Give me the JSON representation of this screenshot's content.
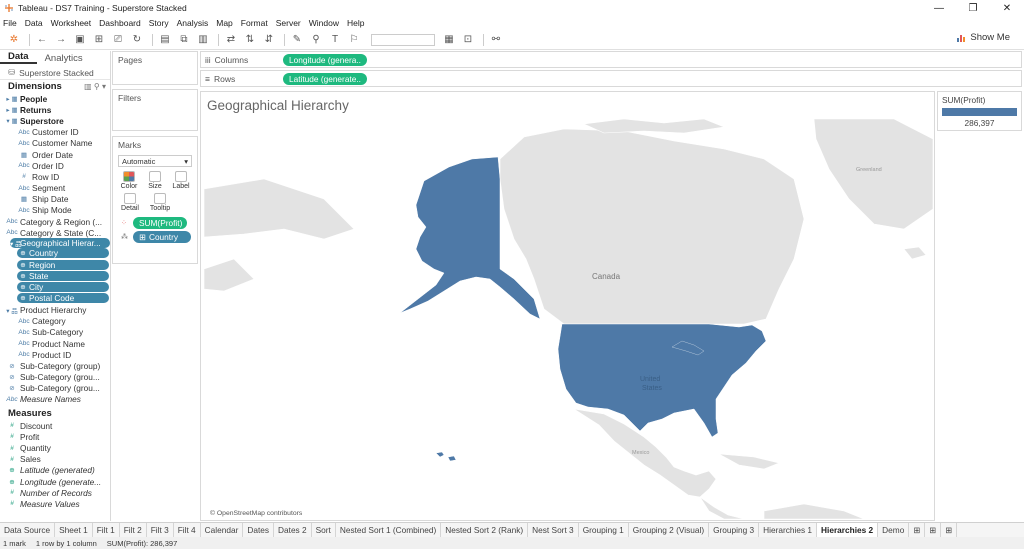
{
  "window": {
    "title": "Tableau - DS7 Training - Superstore Stacked",
    "controls": [
      "—",
      "❐",
      "✕"
    ]
  },
  "menu": [
    "File",
    "Data",
    "Worksheet",
    "Dashboard",
    "Story",
    "Analysis",
    "Map",
    "Format",
    "Server",
    "Window",
    "Help"
  ],
  "toolbar": {
    "show_me": "Show Me"
  },
  "left_panel": {
    "tabs": [
      "Data",
      "Analytics"
    ],
    "datasource": "Superstore Stacked",
    "dimensions_label": "Dimensions",
    "measures_label": "Measures",
    "dimension_rows": [
      {
        "icon": "▸ ▦",
        "label": "People",
        "kind": "grp"
      },
      {
        "icon": "▸ ▦",
        "label": "Returns",
        "kind": "grp"
      },
      {
        "icon": "▾ ▦",
        "label": "Superstore",
        "kind": "grp"
      },
      {
        "icon": "Abc",
        "label": "Customer ID",
        "kind": "indent"
      },
      {
        "icon": "Abc",
        "label": "Customer Name",
        "kind": "indent"
      },
      {
        "icon": "▦",
        "label": "Order Date",
        "kind": "indent"
      },
      {
        "icon": "Abc",
        "label": "Order ID",
        "kind": "indent"
      },
      {
        "icon": "#",
        "label": "Row ID",
        "kind": "indent"
      },
      {
        "icon": "Abc",
        "label": "Segment",
        "kind": "indent"
      },
      {
        "icon": "▦",
        "label": "Ship Date",
        "kind": "indent"
      },
      {
        "icon": "Abc",
        "label": "Ship Mode",
        "kind": "indent"
      },
      {
        "icon": "Abc",
        "label": "Category & Region (...",
        "kind": "plain"
      },
      {
        "icon": "Abc",
        "label": "Category & State (C...",
        "kind": "plain"
      },
      {
        "icon": "▾ 品",
        "label": "Geographical Hierar...",
        "kind": "hier"
      },
      {
        "icon": "⊕",
        "label": "Country",
        "kind": "pill"
      },
      {
        "icon": "⊕",
        "label": "Region",
        "kind": "pill"
      },
      {
        "icon": "⊕",
        "label": "State",
        "kind": "pill"
      },
      {
        "icon": "⊕",
        "label": "City",
        "kind": "pill"
      },
      {
        "icon": "⊕",
        "label": "Postal Code",
        "kind": "pill"
      },
      {
        "icon": "▾ 品",
        "label": "Product Hierarchy",
        "kind": "plain"
      },
      {
        "icon": "Abc",
        "label": "Category",
        "kind": "indent"
      },
      {
        "icon": "Abc",
        "label": "Sub-Category",
        "kind": "indent"
      },
      {
        "icon": "Abc",
        "label": "Product Name",
        "kind": "indent"
      },
      {
        "icon": "Abc",
        "label": "Product ID",
        "kind": "indent"
      },
      {
        "icon": "⊘",
        "label": "Sub-Category (group)",
        "kind": "plain"
      },
      {
        "icon": "⊘",
        "label": "Sub-Category (grou...",
        "kind": "plain"
      },
      {
        "icon": "⊘",
        "label": "Sub-Category (grou...",
        "kind": "plain"
      },
      {
        "icon": "Abc",
        "label": "Measure Names",
        "kind": "italic"
      }
    ],
    "measure_rows": [
      {
        "icon": "#",
        "label": "Discount",
        "kind": "plain"
      },
      {
        "icon": "#",
        "label": "Profit",
        "kind": "plain"
      },
      {
        "icon": "#",
        "label": "Quantity",
        "kind": "plain"
      },
      {
        "icon": "#",
        "label": "Sales",
        "kind": "plain"
      },
      {
        "icon": "⊕",
        "label": "Latitude (generated)",
        "kind": "italic"
      },
      {
        "icon": "⊕",
        "label": "Longitude (generate...",
        "kind": "italic"
      },
      {
        "icon": "#",
        "label": "Number of Records",
        "kind": "italic"
      },
      {
        "icon": "#",
        "label": "Measure Values",
        "kind": "italic"
      }
    ]
  },
  "cards": {
    "pages": "Pages",
    "filters": "Filters",
    "marks": "Marks",
    "mark_type": "Automatic",
    "mark_buttons": [
      "Color",
      "Size",
      "Label",
      "Detail",
      "Tooltip"
    ],
    "mark_pills": [
      {
        "label": "SUM(Profit)",
        "color": "#1eb97f"
      },
      {
        "label": "Country",
        "color": "#3e87a8"
      }
    ]
  },
  "shelves": {
    "columns_label": "Columns",
    "columns_pill": "Longitude (genera..",
    "rows_label": "Rows",
    "rows_pill": "Latitude (generate.."
  },
  "view": {
    "title": "Geographical Hierarchy",
    "map_labels": {
      "canada": "Canada",
      "us": "United\nStates",
      "greenland": "Greenland",
      "mexico": "Mexico"
    },
    "attribution": "© OpenStreetMap contributors",
    "fill_color": "#4e79a7"
  },
  "legend": {
    "title": "SUM(Profit)",
    "value": "286,397",
    "color": "#4e79a7"
  },
  "sheet_tabs": {
    "items": [
      "Data Source",
      "Sheet 1",
      "Filt 1",
      "Filt 2",
      "Filt 3",
      "Filt 4",
      "Calendar",
      "Dates",
      "Dates 2",
      "Sort",
      "Nested Sort 1 (Combined)",
      "Nested Sort 2 (Rank)",
      "Nest Sort 3",
      "Grouping 1",
      "Grouping 2 (Visual)",
      "Grouping 3",
      "Hierarchies 1",
      "Hierarchies 2",
      "Demo"
    ],
    "active": "Hierarchies 2"
  },
  "status": {
    "marks": "1 mark",
    "dims": "1 row by 1 column",
    "sum": "SUM(Profit): 286,397"
  }
}
